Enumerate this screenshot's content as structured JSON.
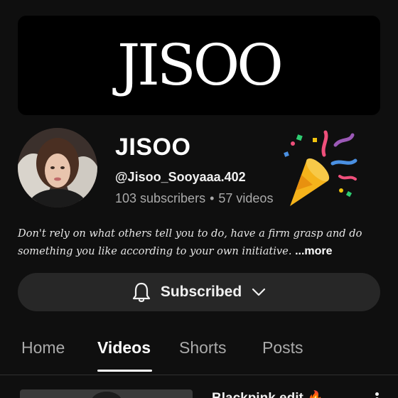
{
  "banner": {
    "logo_text": "JISOO"
  },
  "channel": {
    "name": "JISOO",
    "handle": "@Jisoo_Sooyaaa.402",
    "subscribers": "103 subscribers",
    "separator": "•",
    "videos": "57 videos",
    "description": "Don't rely on what others tell you to do, have a firm grasp and do something you like according to your own initiative.",
    "more_label": "...more"
  },
  "subscribe": {
    "label": "Subscribed"
  },
  "tabs": [
    {
      "label": "Home",
      "active": false
    },
    {
      "label": "Videos",
      "active": true
    },
    {
      "label": "Shorts",
      "active": false
    },
    {
      "label": "Posts",
      "active": false
    }
  ],
  "video": {
    "title": "Blackpink edit 🔥"
  },
  "colors": {
    "background": "#0f0f0f",
    "banner": "#000000",
    "button": "#272727",
    "secondary_text": "#aaaaaa",
    "primary_text": "#f1f1f1"
  },
  "icons": {
    "bell": "bell-icon",
    "chevron": "chevron-down-icon",
    "party": "party-popper-icon",
    "menu": "more-vertical-icon"
  }
}
